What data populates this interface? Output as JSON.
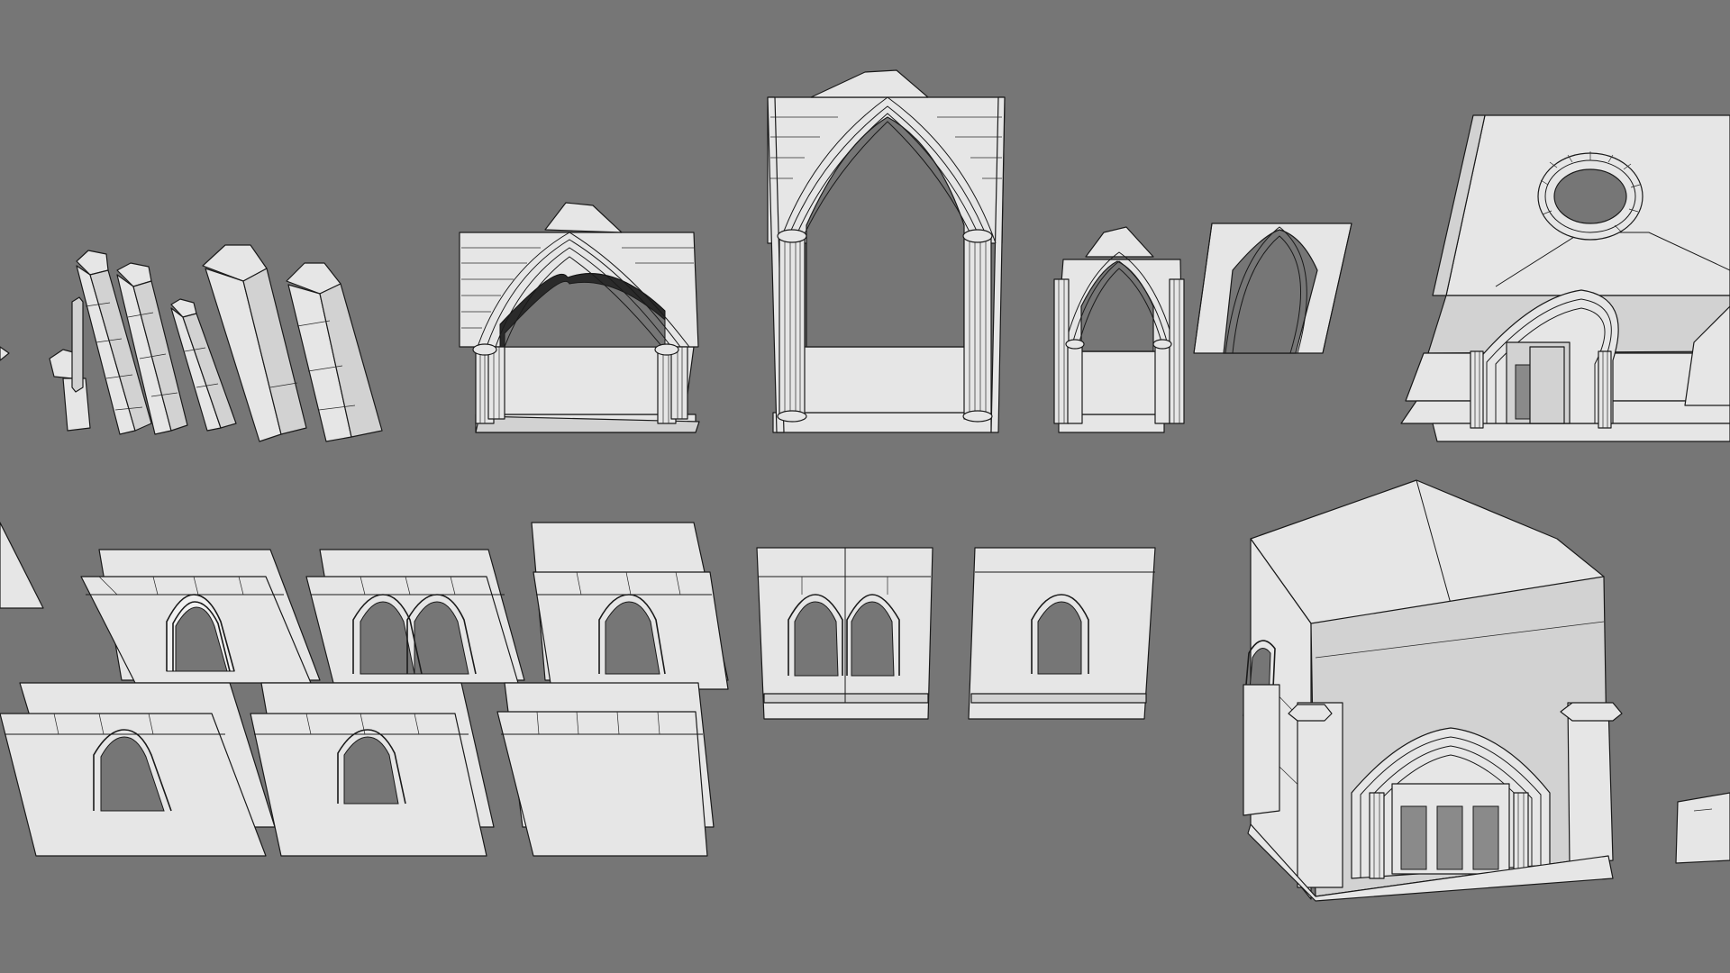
{
  "viewport": {
    "background_color": "#767676",
    "model_fill_color": "#e6e6e6",
    "wire_color": "#1a1a1a"
  },
  "objects": [
    "pillar-cluster",
    "small-gothic-arch",
    "tall-gothic-arch",
    "narrow-gothic-arch",
    "wall-arch-frame",
    "rose-window-facade",
    "window-wall-single",
    "window-wall-double",
    "window-wall-single-b",
    "window-wall-double-c",
    "window-wall-single-c",
    "window-wall-low-a",
    "window-wall-low-b",
    "plain-wall-panel",
    "chapel-building"
  ]
}
